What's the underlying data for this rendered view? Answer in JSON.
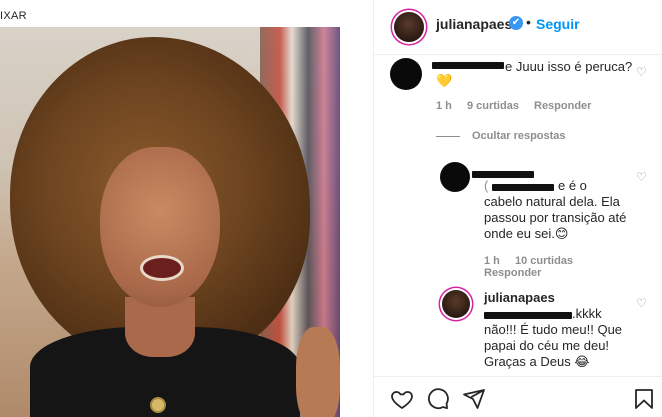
{
  "photo": {
    "edge_label": "IXAR"
  },
  "header": {
    "username": "julianapaes",
    "verified_mark": "✔",
    "separator": "•",
    "follow_label": "Seguir"
  },
  "comments": [
    {
      "text_visible": "e Juuu isso é peruca?",
      "reaction_emoji": "💛",
      "time": "1 h",
      "likes": "9 curtidas",
      "reply": "Responder"
    }
  ],
  "hide_replies": "Ocultar respostas",
  "replies": [
    {
      "line1_suffix": "e é o",
      "line2": "cabelo natural dela. Ela",
      "line3": "passou por transição até",
      "line4": "onde eu sei.😊",
      "time": "1 h",
      "likes": "10 curtidas",
      "reply": "Responder"
    },
    {
      "username": "julianapaes",
      "line1_suffix": ".kkkk",
      "line2": "não!!! É tudo meu!! Que",
      "line3": "papai do céu me deu!",
      "line4": "Graças a Deus 😂"
    }
  ],
  "icons": [
    "heart-icon",
    "comment-icon",
    "share-icon",
    "bookmark-icon"
  ]
}
